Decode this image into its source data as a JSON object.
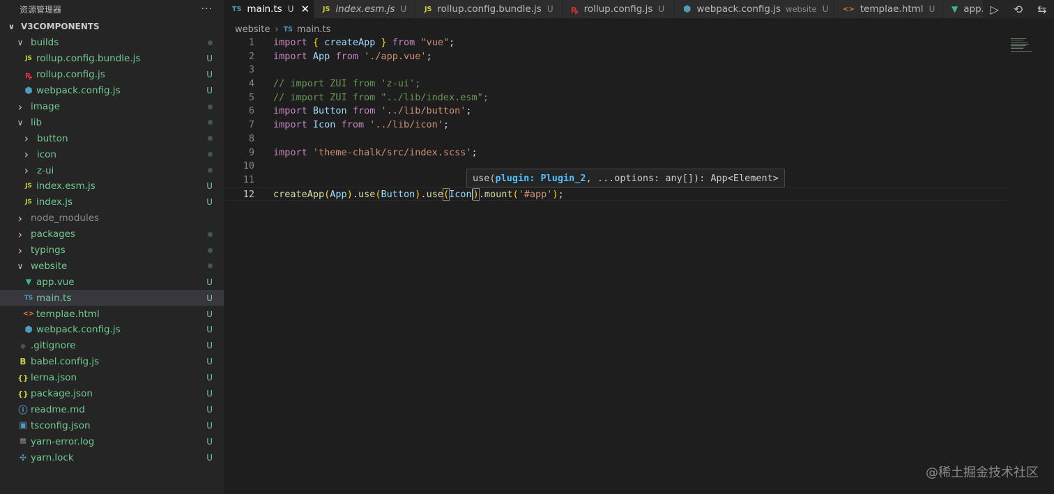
{
  "explorer": {
    "title": "资源管理器",
    "more": "···",
    "root": "V3COMPONENTS",
    "items": [
      {
        "label": "builds",
        "icon": "folder",
        "expanded": true,
        "status": "dot"
      },
      {
        "label": "rollup.config.bundle.js",
        "icon": "js",
        "status": "U"
      },
      {
        "label": "rollup.config.js",
        "icon": "rollup",
        "status": "U"
      },
      {
        "label": "webpack.config.js",
        "icon": "webpack",
        "status": "U"
      },
      {
        "label": "image",
        "icon": "folder",
        "expanded": false,
        "status": "dot"
      },
      {
        "label": "lib",
        "icon": "folder",
        "expanded": true,
        "status": "dot"
      },
      {
        "label": "button",
        "icon": "folder",
        "expanded": false,
        "status": "dot"
      },
      {
        "label": "icon",
        "icon": "folder",
        "expanded": false,
        "status": "dot"
      },
      {
        "label": "z-ui",
        "icon": "folder",
        "expanded": false,
        "status": "dot"
      },
      {
        "label": "index.esm.js",
        "icon": "js",
        "status": "U"
      },
      {
        "label": "index.js",
        "icon": "js",
        "status": "U"
      },
      {
        "label": "node_modules",
        "icon": "folder",
        "expanded": false,
        "status": ""
      },
      {
        "label": "packages",
        "icon": "folder",
        "expanded": false,
        "status": "dot"
      },
      {
        "label": "typings",
        "icon": "folder",
        "expanded": false,
        "status": "dot"
      },
      {
        "label": "website",
        "icon": "folder",
        "expanded": true,
        "status": "dot"
      },
      {
        "label": "app.vue",
        "icon": "vue",
        "status": "U"
      },
      {
        "label": "main.ts",
        "icon": "ts",
        "status": "U",
        "selected": true
      },
      {
        "label": "templae.html",
        "icon": "html",
        "status": "U"
      },
      {
        "label": "webpack.config.js",
        "icon": "webpack",
        "status": "U"
      },
      {
        "label": ".gitignore",
        "icon": "git",
        "status": "U"
      },
      {
        "label": "babel.config.js",
        "icon": "babel",
        "status": "U"
      },
      {
        "label": "lerna.json",
        "icon": "json",
        "status": "U"
      },
      {
        "label": "package.json",
        "icon": "json",
        "status": "U"
      },
      {
        "label": "readme.md",
        "icon": "info",
        "status": "U"
      },
      {
        "label": "tsconfig.json",
        "icon": "tsconfig",
        "status": "U"
      },
      {
        "label": "yarn-error.log",
        "icon": "log",
        "status": "U"
      },
      {
        "label": "yarn.lock",
        "icon": "yarn",
        "status": "U"
      }
    ]
  },
  "tabs": [
    {
      "label": "main.ts",
      "icon": "TS",
      "status": "U",
      "active": true,
      "close": "✕"
    },
    {
      "label": "index.esm.js",
      "icon": "JS",
      "status": "U",
      "italic": true
    },
    {
      "label": "rollup.config.bundle.js",
      "icon": "JS",
      "status": "U"
    },
    {
      "label": "rollup.config.js",
      "icon": "rollup",
      "status": "U"
    },
    {
      "label": "webpack.config.js",
      "icon": "webpack",
      "description": "website",
      "status": "U"
    },
    {
      "label": "templae.html",
      "icon": "html",
      "status": "U"
    },
    {
      "label": "app.",
      "icon": "vue",
      "status": ""
    }
  ],
  "breadcrumb": {
    "folder": "website",
    "file": "main.ts"
  },
  "editor": {
    "lines": [
      {
        "n": "1",
        "tokens": [
          [
            "kw",
            "import"
          ],
          [
            "pn",
            " "
          ],
          [
            "br2",
            "{"
          ],
          [
            "pn",
            " "
          ],
          [
            "id",
            "createApp"
          ],
          [
            "pn",
            " "
          ],
          [
            "br2",
            "}"
          ],
          [
            "pn",
            " "
          ],
          [
            "kw",
            "from"
          ],
          [
            "pn",
            " "
          ],
          [
            "st",
            "\"vue\""
          ],
          [
            "pn",
            ";"
          ]
        ]
      },
      {
        "n": "2",
        "tokens": [
          [
            "kw",
            "import"
          ],
          [
            "pn",
            " "
          ],
          [
            "id",
            "App"
          ],
          [
            "pn",
            " "
          ],
          [
            "kw",
            "from"
          ],
          [
            "pn",
            " "
          ],
          [
            "st",
            "'./app.vue'"
          ],
          [
            "pn",
            ";"
          ]
        ]
      },
      {
        "n": "3",
        "tokens": []
      },
      {
        "n": "4",
        "tokens": [
          [
            "cm",
            "// import ZUI from 'z-ui';"
          ]
        ]
      },
      {
        "n": "5",
        "tokens": [
          [
            "cm",
            "// import ZUI from \"../lib/index.esm\";"
          ]
        ]
      },
      {
        "n": "6",
        "tokens": [
          [
            "kw",
            "import"
          ],
          [
            "pn",
            " "
          ],
          [
            "id",
            "Button"
          ],
          [
            "pn",
            " "
          ],
          [
            "kw",
            "from"
          ],
          [
            "pn",
            " "
          ],
          [
            "st",
            "'../lib/button'"
          ],
          [
            "pn",
            ";"
          ]
        ]
      },
      {
        "n": "7",
        "tokens": [
          [
            "kw",
            "import"
          ],
          [
            "pn",
            " "
          ],
          [
            "id",
            "Icon"
          ],
          [
            "pn",
            " "
          ],
          [
            "kw",
            "from"
          ],
          [
            "pn",
            " "
          ],
          [
            "st",
            "'../lib/icon'"
          ],
          [
            "pn",
            ";"
          ]
        ]
      },
      {
        "n": "8",
        "tokens": []
      },
      {
        "n": "9",
        "tokens": [
          [
            "kw",
            "import"
          ],
          [
            "pn",
            " "
          ],
          [
            "st",
            "'theme-chalk/src/index.scss'"
          ],
          [
            "pn",
            ";"
          ]
        ]
      },
      {
        "n": "10",
        "tokens": []
      },
      {
        "n": "11",
        "tokens": []
      },
      {
        "n": "12",
        "current": true,
        "tokens": [
          [
            "fn",
            "createApp"
          ],
          [
            "br2",
            "("
          ],
          [
            "id",
            "App"
          ],
          [
            "br2",
            ")"
          ],
          [
            "pn",
            "."
          ],
          [
            "fn",
            "use"
          ],
          [
            "br2",
            "("
          ],
          [
            "id",
            "Button"
          ],
          [
            "br2",
            ")"
          ],
          [
            "pn",
            "."
          ],
          [
            "fn",
            "use"
          ],
          [
            "br2 brhl",
            "("
          ],
          [
            "id cursor",
            "Icon"
          ],
          [
            "br2 brhl",
            ")"
          ],
          [
            "pn",
            "."
          ],
          [
            "fn",
            "mount"
          ],
          [
            "br2",
            "("
          ],
          [
            "st",
            "'#app'"
          ],
          [
            "br2",
            ")"
          ],
          [
            "pn",
            ";"
          ]
        ]
      }
    ]
  },
  "hover": {
    "before": "use(",
    "param": "plugin: Plugin_2",
    "after": ", ...options: any[]): App<Element>"
  },
  "actions": [
    "run-icon",
    "history-icon",
    "compare-icon"
  ],
  "watermark": "@稀土掘金技术社区"
}
